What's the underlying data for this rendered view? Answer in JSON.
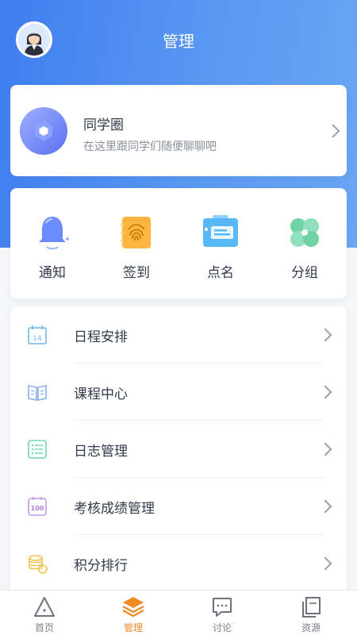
{
  "header": {
    "title": "管理"
  },
  "classmate_circle": {
    "title": "同学圈",
    "subtitle": "在这里跟同学们随便聊聊吧"
  },
  "quick_actions": [
    {
      "label": "通知",
      "icon": "bell-icon"
    },
    {
      "label": "签到",
      "icon": "fingerprint-icon"
    },
    {
      "label": "点名",
      "icon": "roll-call-icon"
    },
    {
      "label": "分组",
      "icon": "clover-group-icon"
    }
  ],
  "menu": [
    {
      "label": "日程安排",
      "icon": "calendar-icon",
      "calendar_day": "14"
    },
    {
      "label": "课程中心",
      "icon": "book-icon"
    },
    {
      "label": "日志管理",
      "icon": "log-list-icon"
    },
    {
      "label": "考核成绩管理",
      "icon": "score-icon",
      "score_text": "100"
    },
    {
      "label": "积分排行",
      "icon": "coins-icon"
    }
  ],
  "tabbar": [
    {
      "label": "首页",
      "icon": "home-triangle-icon",
      "active": false
    },
    {
      "label": "管理",
      "icon": "layers-icon",
      "active": true
    },
    {
      "label": "讨论",
      "icon": "chat-icon",
      "active": false
    },
    {
      "label": "资源",
      "icon": "files-icon",
      "active": false
    }
  ],
  "colors": {
    "primary": "#3f7df0",
    "active_tab": "#f08a24",
    "text": "#333a4d",
    "muted": "#8a8f99"
  }
}
